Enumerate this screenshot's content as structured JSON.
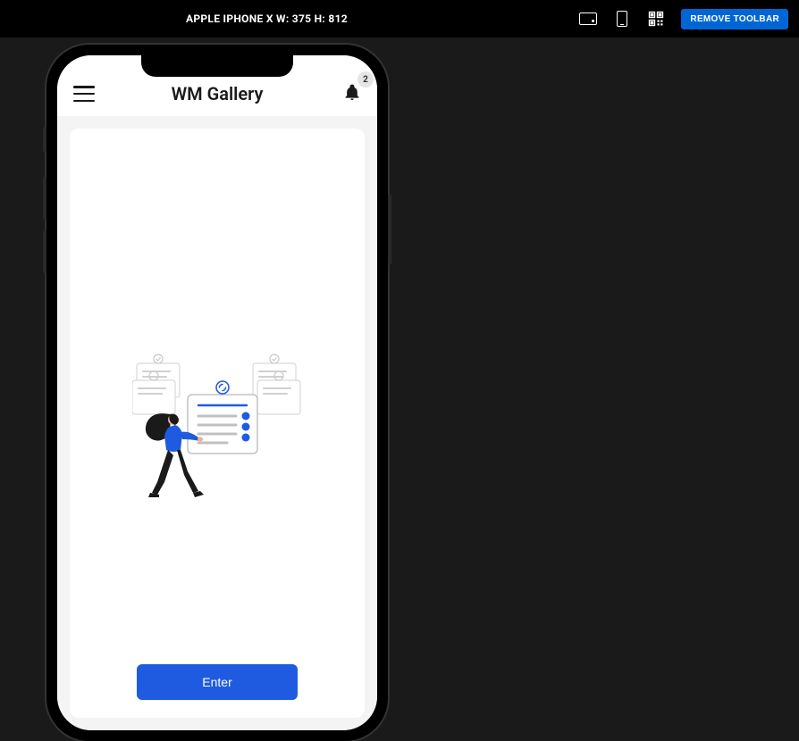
{
  "toolbar": {
    "device_info": "APPLE IPHONE X W: 375 H: 812",
    "remove_label": "REMOVE TOOLBAR"
  },
  "app": {
    "title": "WM Gallery",
    "badge_count": "2",
    "enter_label": "Enter"
  },
  "colors": {
    "primary": "#1e5be0",
    "toolbar_button": "#0066d6",
    "background_dark": "#1a1a1a"
  },
  "icons": {
    "hamburger": "hamburger-icon",
    "bell": "bell-icon",
    "landscape": "landscape-icon",
    "portrait": "portrait-icon",
    "qr": "qr-code-icon"
  }
}
